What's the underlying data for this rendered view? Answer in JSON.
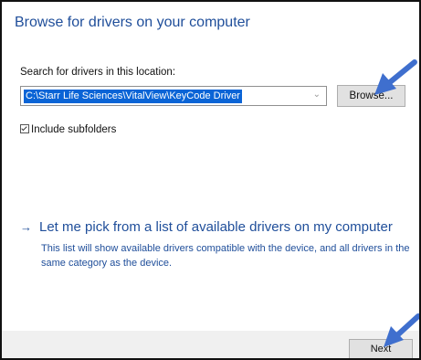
{
  "dialog": {
    "title": "Browse for drivers on your computer"
  },
  "search": {
    "label": "Search for drivers in this location:",
    "path_value": "C:\\Starr Life Sciences\\VitalView\\KeyCode Driver",
    "browse_label": "Browse..."
  },
  "options": {
    "include_subfolders_label": "Include subfolders",
    "include_subfolders_checked": true
  },
  "pick": {
    "arrow": "→",
    "link_text": "Let me pick from a list of available drivers on my computer",
    "description": "This list will show available drivers compatible with the device, and all drivers in the same category as the device."
  },
  "footer": {
    "next_label": "Next"
  },
  "colors": {
    "accent_text": "#1f4e9a",
    "selection": "#0a64d6",
    "annotation_arrow": "#3f6fce"
  }
}
